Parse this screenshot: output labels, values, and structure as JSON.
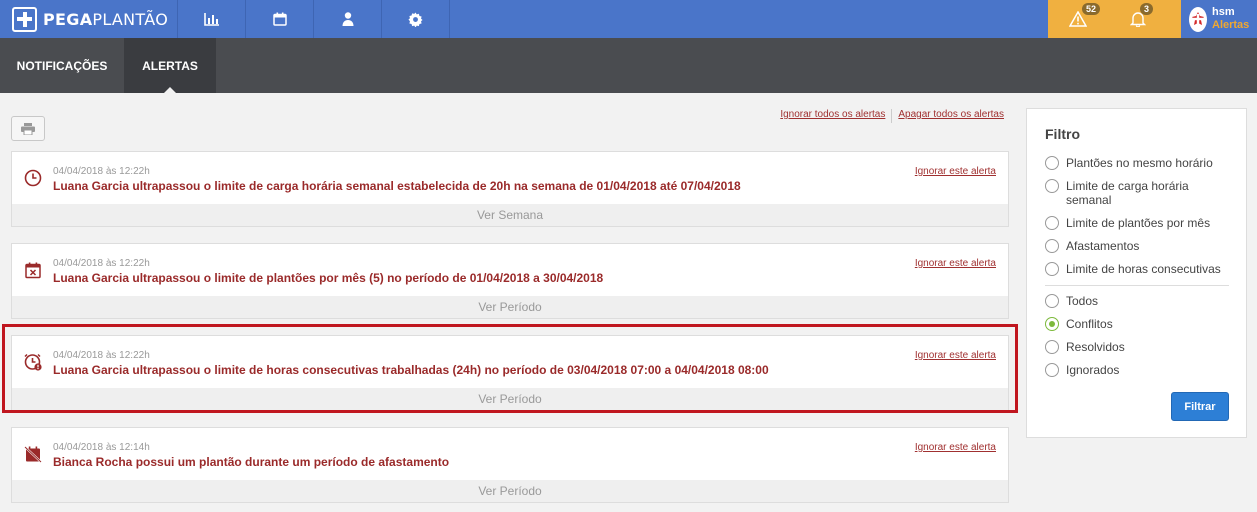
{
  "header": {
    "logo_text_bold": "PEGA",
    "logo_text_rest": "PLANTÃO",
    "nav_icons": [
      "chart-icon",
      "calendar-icon",
      "user-icon",
      "gear-icon"
    ],
    "warnings_count": "52",
    "notifications_count": "3",
    "user_name": "hsm",
    "user_role": "Alertas"
  },
  "subnav": {
    "tabs": [
      {
        "label": "NOTIFICAÇÕES",
        "active": false
      },
      {
        "label": "ALERTAS",
        "active": true
      }
    ]
  },
  "actions": {
    "ignore_all": "Ignorar todos os alertas",
    "delete_all": "Apagar todos os alertas"
  },
  "alerts": [
    {
      "icon": "clock-icon",
      "time": "04/04/2018 às 12:22h",
      "message": "Luana Garcia ultrapassou o limite de carga horária semanal estabelecida de 20h na semana de 01/04/2018 até 07/04/2018",
      "ignore": "Ignorar este alerta",
      "footer": "Ver Semana"
    },
    {
      "icon": "calendar-x-icon",
      "time": "04/04/2018 às 12:22h",
      "message": "Luana Garcia ultrapassou o limite de plantões por mês (5) no período de 01/04/2018 a 30/04/2018",
      "ignore": "Ignorar este alerta",
      "footer": "Ver Período"
    },
    {
      "icon": "clock-alert-icon",
      "time": "04/04/2018 às 12:22h",
      "message": "Luana Garcia ultrapassou o limite de horas consecutivas trabalhadas (24h) no período de 03/04/2018 07:00 a 04/04/2018 08:00",
      "ignore": "Ignorar este alerta",
      "footer": "Ver Período"
    },
    {
      "icon": "calendar-off-icon",
      "time": "04/04/2018 às 12:14h",
      "message": "Bianca Rocha possui um plantão durante um período de afastamento",
      "ignore": "Ignorar este alerta",
      "footer": "Ver Período"
    }
  ],
  "filter": {
    "title": "Filtro",
    "types": [
      {
        "label": "Plantões no mesmo horário",
        "checked": false
      },
      {
        "label": "Limite de carga horária semanal",
        "checked": false
      },
      {
        "label": "Limite de plantões por mês",
        "checked": false
      },
      {
        "label": "Afastamentos",
        "checked": false
      },
      {
        "label": "Limite de horas consecutivas",
        "checked": false
      }
    ],
    "statuses": [
      {
        "label": "Todos",
        "checked": false
      },
      {
        "label": "Conflitos",
        "checked": true
      },
      {
        "label": "Resolvidos",
        "checked": false
      },
      {
        "label": "Ignorados",
        "checked": false
      }
    ],
    "button": "Filtrar"
  },
  "colors": {
    "topbar": "#4a75c9",
    "warning_area": "#f0b040",
    "subnav": "#4a4c50",
    "alert_text": "#9a2a2a",
    "highlight": "#c0161f",
    "filter_button": "#2d7fd6"
  }
}
